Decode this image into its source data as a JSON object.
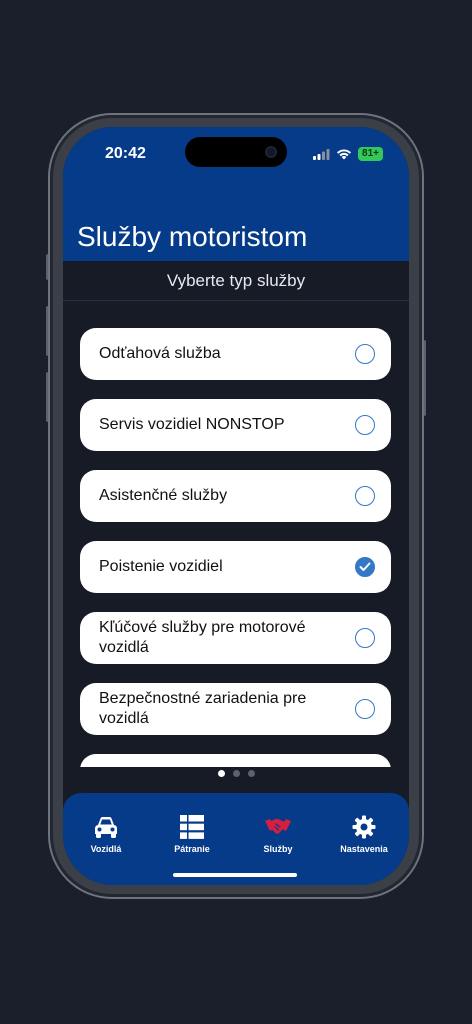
{
  "status_bar": {
    "time": "20:42",
    "battery": "81+"
  },
  "header": {
    "title": "Služby motoristom"
  },
  "subheader": {
    "title": "Vyberte typ služby"
  },
  "services": [
    {
      "label": "Odťahová služba",
      "selected": false
    },
    {
      "label": "Servis vozidiel NONSTOP",
      "selected": false
    },
    {
      "label": "Asistenčné služby",
      "selected": false
    },
    {
      "label": "Poistenie vozidiel",
      "selected": true
    },
    {
      "label": "Kľúčové služby pre motorové vozidlá",
      "selected": false
    },
    {
      "label": "Bezpečnostné zariadenia pre vozidlá",
      "selected": false
    }
  ],
  "pager": {
    "page": 1,
    "pages": 3
  },
  "tabs": [
    {
      "label": "Vozidlá",
      "icon": "car-icon",
      "active": false
    },
    {
      "label": "Pátranie",
      "icon": "list-icon",
      "active": false
    },
    {
      "label": "Služby",
      "icon": "handshake-icon",
      "active": true
    },
    {
      "label": "Nastavenia",
      "icon": "gear-icon",
      "active": false
    }
  ],
  "colors": {
    "brand": "#063b8a",
    "accent": "#3478c6",
    "active_tab_icon": "#d81e3f"
  }
}
